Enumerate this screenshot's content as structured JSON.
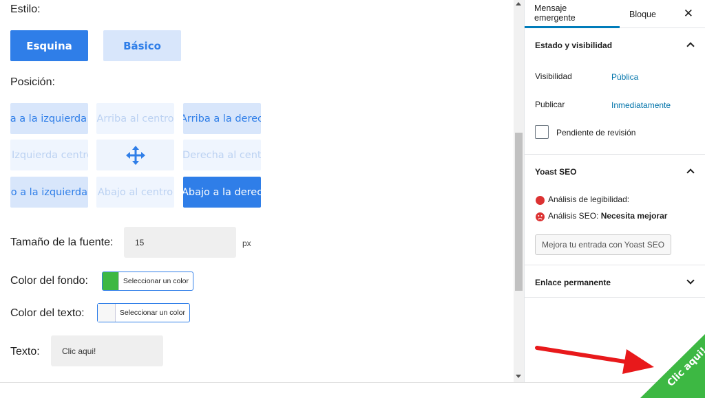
{
  "editor": {
    "style_label": "Estilo:",
    "style_buttons": {
      "active": "Esquina",
      "inactive": "Básico"
    },
    "position_label": "Posición:",
    "positions": {
      "top_left": "Arriba a la izquierda",
      "top_center": "Arriba al centro",
      "top_right": "Arriba a la derecha",
      "mid_left": "Izquierda centro",
      "mid_right": "Derecha al centro",
      "bot_left": "Abajo a la izquierda",
      "bot_center": "Abajo al centro",
      "bot_right": "Abajo a la derecha"
    },
    "font_size_label": "Tamaño de la fuente:",
    "font_size_value": "15",
    "font_size_unit": "px",
    "bg_color_label": "Color del fondo:",
    "bg_color_button": "Seleccionar un color",
    "bg_color_value": "#3db843",
    "text_color_label": "Color del texto:",
    "text_color_button": "Seleccionar un color",
    "text_color_value": "#ffffff",
    "text_label": "Texto:",
    "text_value": "Clic aqui!"
  },
  "sidebar": {
    "tabs": [
      "Mensaje emergente",
      "Bloque"
    ],
    "close_icon": "close-icon",
    "status": {
      "title": "Estado y visibilidad",
      "visibility_label": "Visibilidad",
      "visibility_value": "Pública",
      "publish_label": "Publicar",
      "publish_value": "Inmediatamente",
      "pending_label": "Pendiente de revisión"
    },
    "yoast": {
      "title": "Yoast SEO",
      "readability": "Análisis de legibilidad:",
      "seo_prefix": "Análisis SEO: ",
      "seo_status": "Necesita mejorar",
      "button": "Mejora tu entrada con Yoast SEO"
    },
    "permalink": {
      "title": "Enlace permanente"
    }
  },
  "ribbon": {
    "text": "Clic aqui!",
    "color": "#3db843"
  },
  "colors": {
    "accent": "#2f7ee8",
    "link": "#0073aa",
    "arrow": "#e8191b"
  }
}
